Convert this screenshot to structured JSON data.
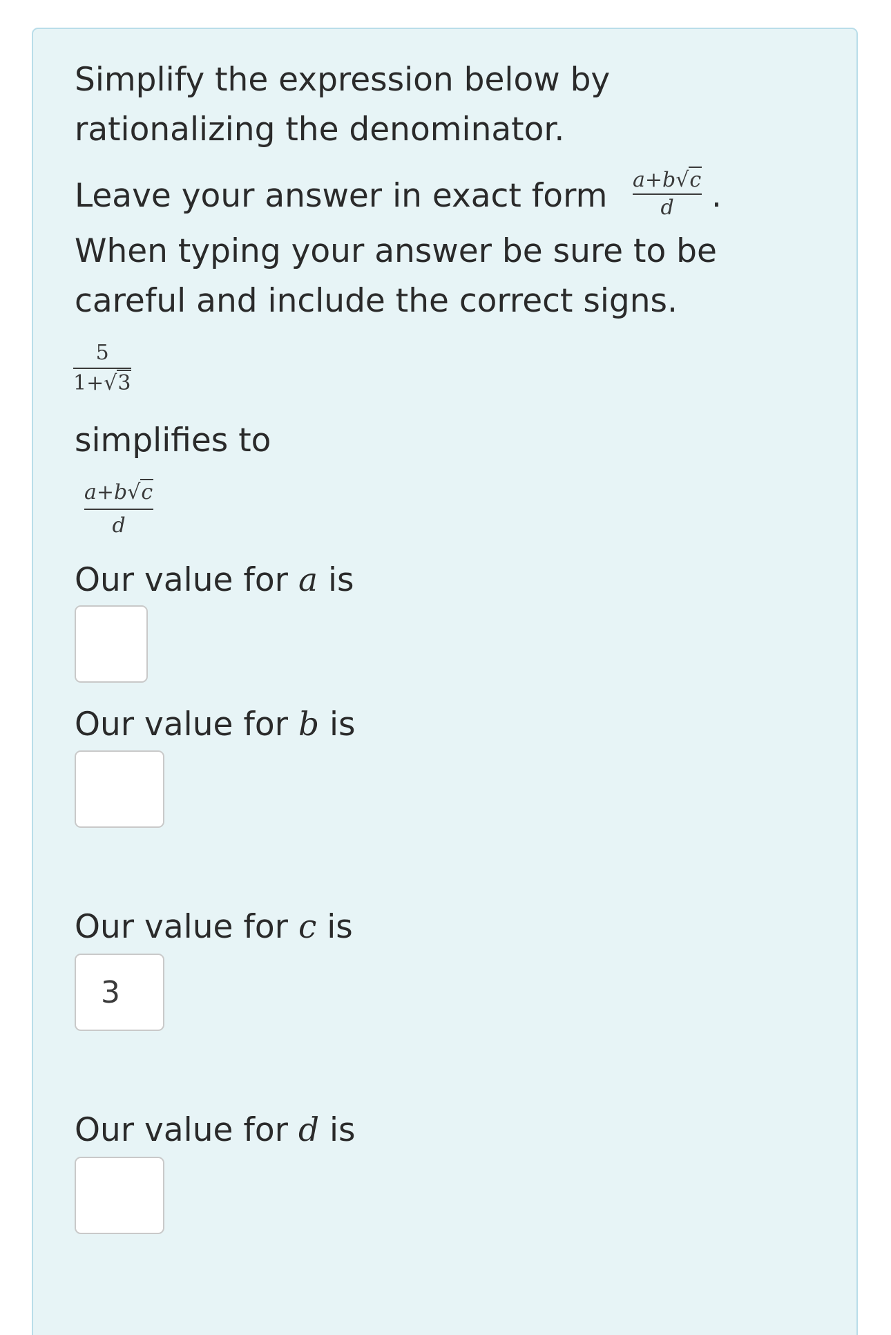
{
  "prompt": {
    "line1": "Simplify the expression below by",
    "line2": "rationalizing the denominator.",
    "exact_form_prefix": "Leave your answer in exact form",
    "exact_form_suffix": ".",
    "line4": "When typing your answer be sure to be",
    "line5": "careful and include the correct signs."
  },
  "expression": {
    "numerator": "5",
    "denominator_prefix": "1+",
    "denominator_radical": "3"
  },
  "template_fraction": {
    "numerator_prefix": "a+b",
    "numerator_radical": "c",
    "denominator": "d"
  },
  "simplifies_label": "simplifies to",
  "questions": [
    {
      "prefix": "Our value for",
      "variable": "a",
      "suffix": "is",
      "value": ""
    },
    {
      "prefix": "Our value for",
      "variable": "b",
      "suffix": "is",
      "value": ""
    },
    {
      "prefix": "Our value for",
      "variable": "c",
      "suffix": "is",
      "value": "3"
    },
    {
      "prefix": "Our value for",
      "variable": "d",
      "suffix": "is",
      "value": ""
    }
  ],
  "colors": {
    "panel_background": "#e7f4f6",
    "panel_border": "#b9dde9",
    "input_border": "#c9c9c9"
  }
}
